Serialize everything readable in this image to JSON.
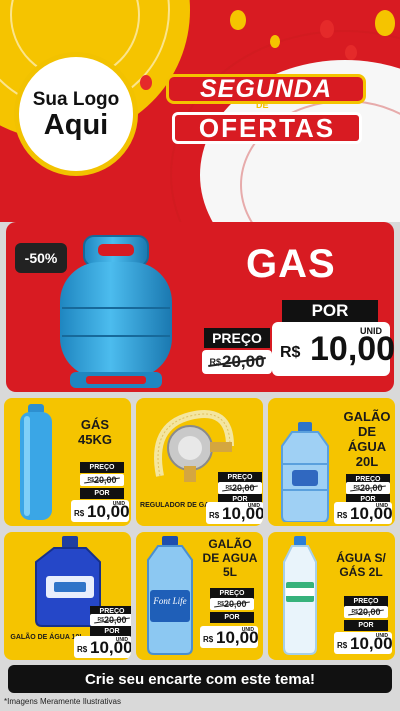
{
  "brand": {
    "logo_line1": "Sua Logo",
    "logo_line2": "Aqui"
  },
  "title": {
    "line1": "SEGUNDA",
    "connector": "DE",
    "line2": "OFERTAS"
  },
  "colors": {
    "red": "#d81b22",
    "yellow": "#f5c400",
    "black": "#111111",
    "tank_blue": "#35a9df"
  },
  "hero": {
    "badge": "-50%",
    "name": "GAS",
    "por_label": "POR",
    "preco_label": "PREÇO",
    "old_currency": "R$",
    "old_value": "20,00",
    "unit": "UNID",
    "currency": "R$",
    "price": "10,00"
  },
  "products": [
    {
      "name": "GÁS 45KG",
      "icon": "gas-cylinder-icon",
      "preco_label": "PREÇO",
      "old_currency": "R$",
      "old_value": "20,00",
      "por_label": "POR",
      "unit": "UNID",
      "currency": "R$",
      "price": "10,00"
    },
    {
      "name": "REGULADOR DE GAS",
      "icon": "gas-regulator-icon",
      "preco_label": "PREÇO",
      "old_currency": "R$",
      "old_value": "20,00",
      "por_label": "POR",
      "unit": "UNID",
      "currency": "R$",
      "price": "10,00"
    },
    {
      "name": "GALÃO DE ÁGUA 20L",
      "icon": "water-jug-icon",
      "preco_label": "PREÇO",
      "old_currency": "R$",
      "old_value": "20,00",
      "por_label": "POR",
      "unit": "UNID",
      "currency": "R$",
      "price": "10,00"
    },
    {
      "name": "GALÃO DE ÁGUA 10L",
      "icon": "water-jug-blue-icon",
      "preco_label": "PREÇO",
      "old_currency": "R$",
      "old_value": "20,00",
      "por_label": "POR",
      "unit": "UNID",
      "currency": "R$",
      "price": "10,00"
    },
    {
      "name": "GALÃO DE AGUA 5L",
      "icon": "water-bottle-5l-icon",
      "bottle_brand": "Font Life",
      "preco_label": "PREÇO",
      "old_currency": "R$",
      "old_value": "20,00",
      "por_label": "POR",
      "unit": "UNID",
      "currency": "R$",
      "price": "10,00"
    },
    {
      "name": "ÁGUA S/ GÁS 2L",
      "icon": "water-bottle-2l-icon",
      "preco_label": "PREÇO",
      "old_currency": "R$",
      "old_value": "20,00",
      "por_label": "POR",
      "unit": "UNID",
      "currency": "R$",
      "price": "10,00"
    }
  ],
  "cta": "Crie seu encarte com este tema!",
  "disclaimer": "*Imagens Meramente Ilustrativas"
}
